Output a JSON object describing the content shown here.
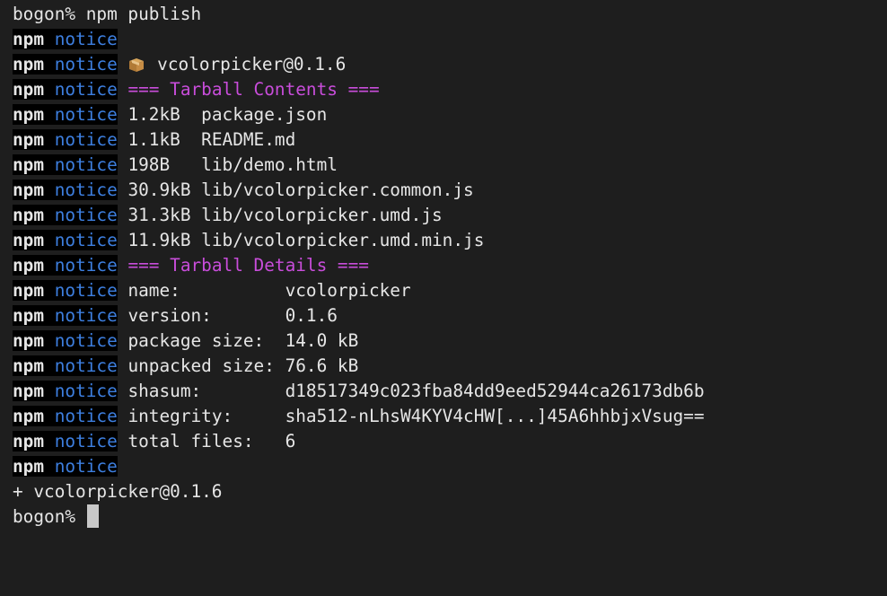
{
  "prompt_command": "bogon% npm publish",
  "prefix": {
    "npm": "npm",
    "notice": "notice"
  },
  "notice_lines": [
    {
      "kind": "blank",
      "text": ""
    },
    {
      "kind": "package",
      "icon": "package-icon",
      "text": "vcolorpicker@0.1.6"
    },
    {
      "kind": "heading",
      "text": "=== Tarball Contents ==="
    },
    {
      "kind": "text",
      "text": "1.2kB  package.json"
    },
    {
      "kind": "text",
      "text": "1.1kB  README.md"
    },
    {
      "kind": "text",
      "text": "198B   lib/demo.html"
    },
    {
      "kind": "text",
      "text": "30.9kB lib/vcolorpicker.common.js"
    },
    {
      "kind": "text",
      "text": "31.3kB lib/vcolorpicker.umd.js"
    },
    {
      "kind": "text",
      "text": "11.9kB lib/vcolorpicker.umd.min.js"
    },
    {
      "kind": "heading",
      "text": "=== Tarball Details ==="
    },
    {
      "kind": "text",
      "text": "name:          vcolorpicker"
    },
    {
      "kind": "text",
      "text": "version:       0.1.6"
    },
    {
      "kind": "text",
      "text": "package size:  14.0 kB"
    },
    {
      "kind": "text",
      "text": "unpacked size: 76.6 kB"
    },
    {
      "kind": "text",
      "text": "shasum:        d18517349c023fba84dd9eed52944ca26173db6b"
    },
    {
      "kind": "text",
      "text": "integrity:     sha512-nLhsW4KYV4cHW[...]45A6hhbjxVsug=="
    },
    {
      "kind": "text",
      "text": "total files:   6"
    },
    {
      "kind": "blank",
      "text": ""
    }
  ],
  "result_line": "+ vcolorpicker@0.1.6",
  "final_prompt": "bogon% ",
  "colors": {
    "background": "#1e1e1e",
    "notice": "#3d7fe0",
    "heading": "#c94ddb",
    "text": "#e6e6e6"
  }
}
